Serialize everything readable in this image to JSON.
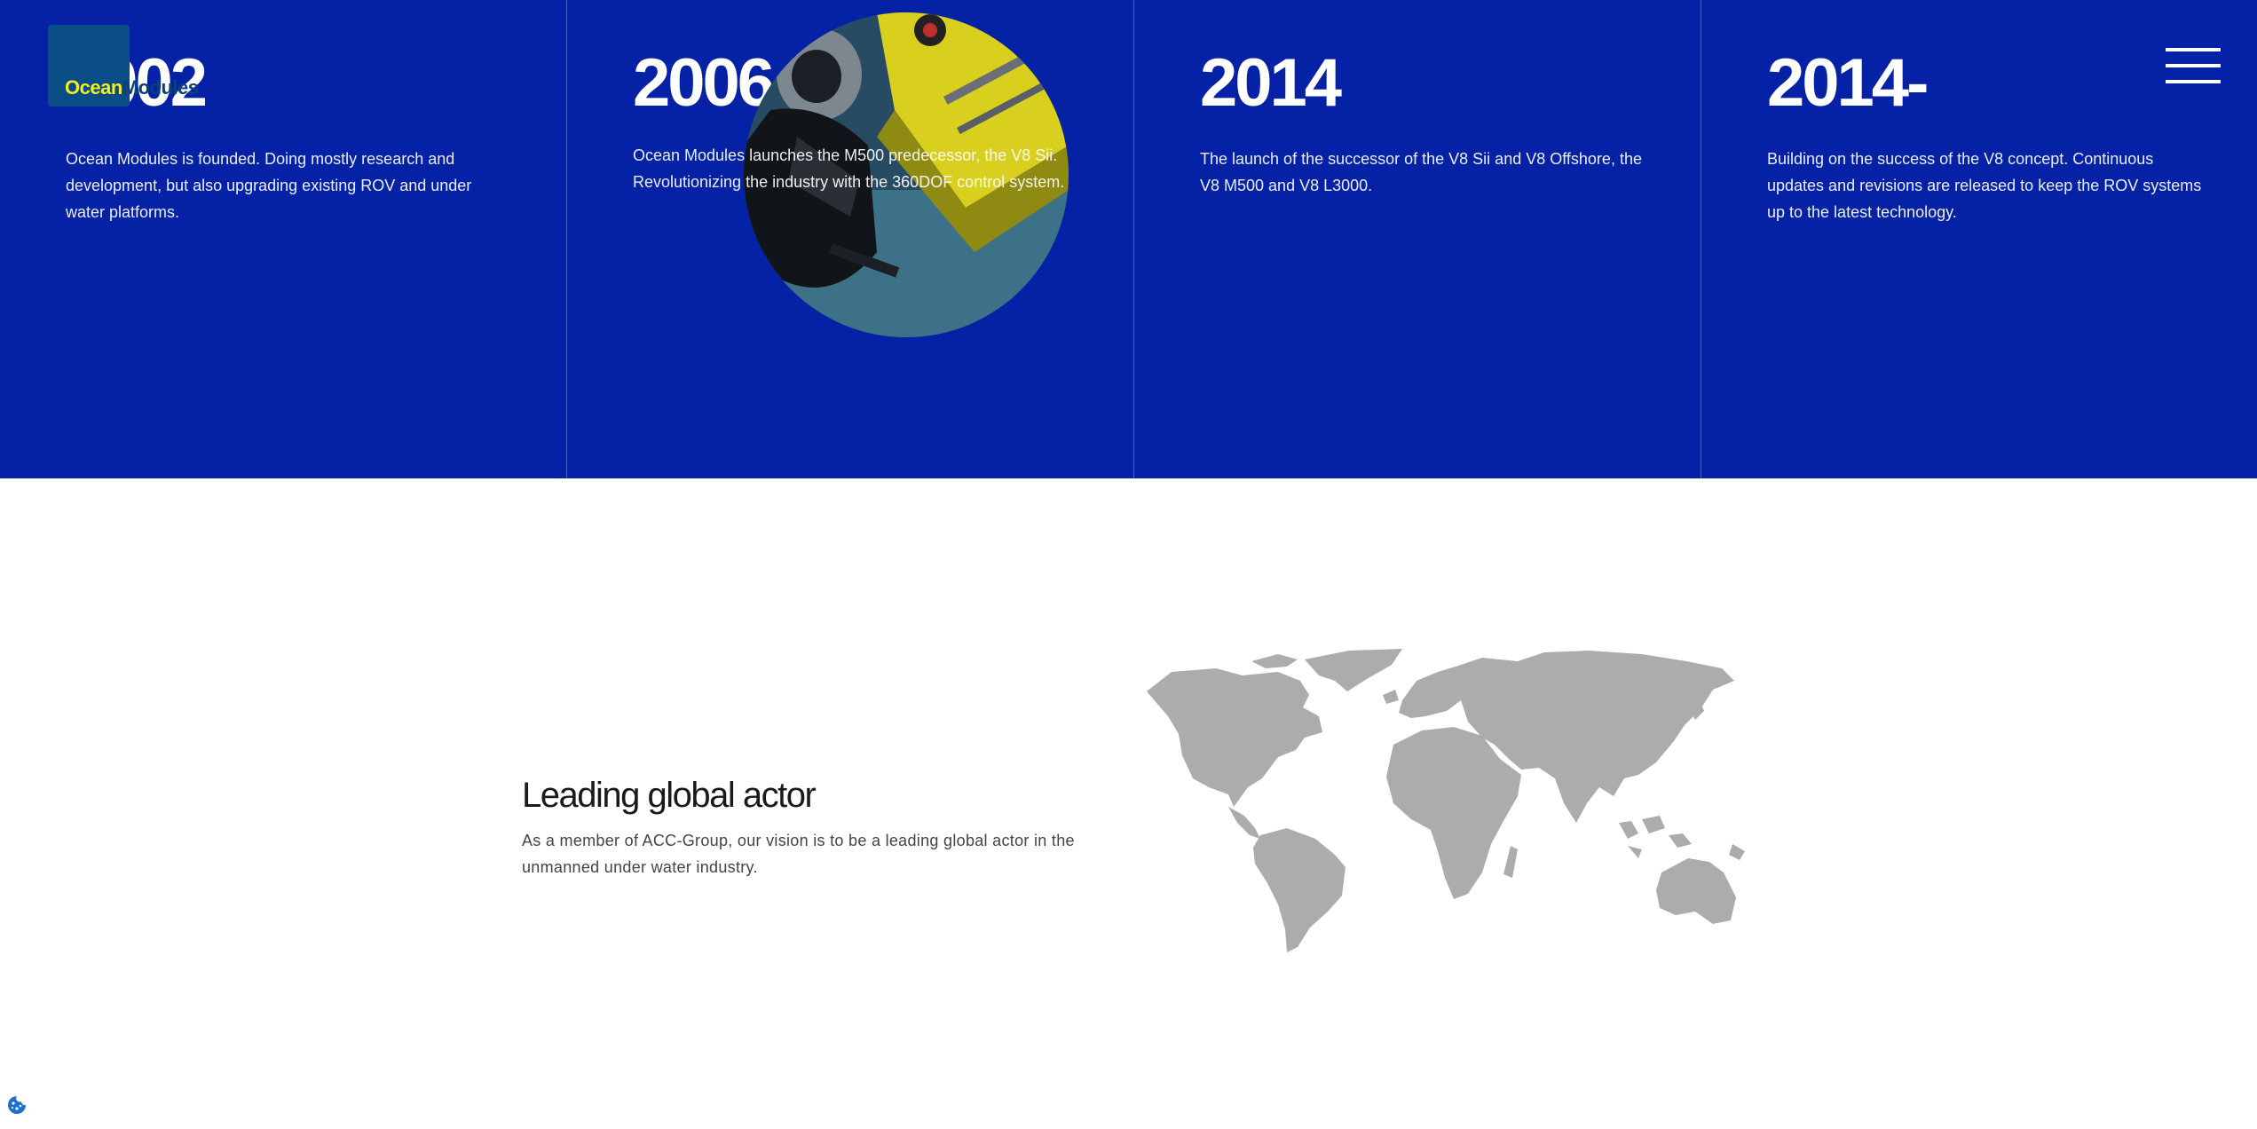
{
  "brand": {
    "name_part1": "Ocean",
    "name_part2": "Modules"
  },
  "timeline": [
    {
      "year": "2002",
      "description": "Ocean Modules is founded. Doing mostly research and development, but also upgrading existing ROV and under water platforms."
    },
    {
      "year": "2006",
      "description": "Ocean Modules launches the M500 predecessor, the V8 Sii. Revolutionizing the industry with the 360DOF control system."
    },
    {
      "year": "2014",
      "description": "The launch of the successor of the V8 Sii and V8 Offshore, the V8 M500 and V8 L3000."
    },
    {
      "year": "2014-",
      "description": "Building on the success of the V8 concept. Continuous updates and revisions are released to keep the ROV systems up to the latest technology."
    }
  ],
  "about": {
    "heading": "Leading global actor",
    "text": "As a member of ACC-Group, our vision is to be a leading global actor in the unmanned under water industry."
  },
  "icons": {
    "menu": "hamburger-menu-icon",
    "cookie": "cookie-icon"
  },
  "colors": {
    "timeline_bg": "#0522a7",
    "logo_accent": "#f4ef23",
    "map_fill": "#acacac",
    "cookie_icon": "#1a6fd1"
  }
}
